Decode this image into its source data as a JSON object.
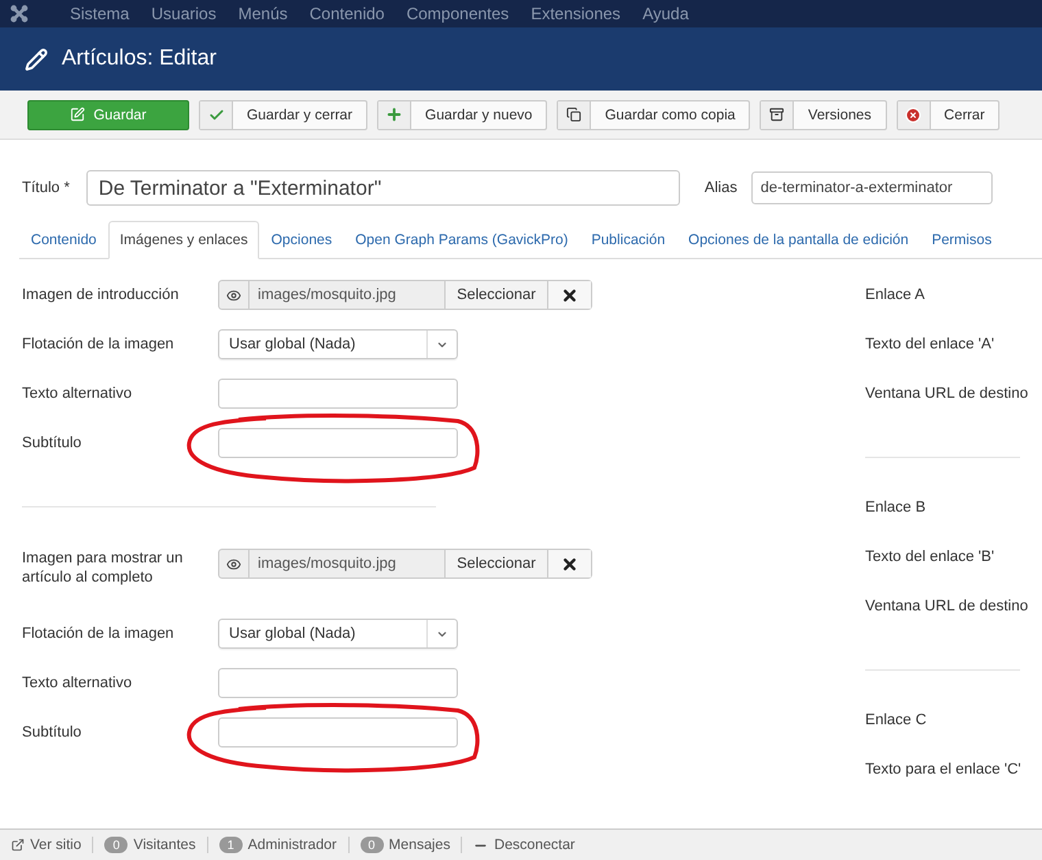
{
  "top_menu": {
    "items": [
      "Sistema",
      "Usuarios",
      "Menús",
      "Contenido",
      "Componentes",
      "Extensiones",
      "Ayuda"
    ]
  },
  "header": {
    "title": "Artículos: Editar"
  },
  "toolbar": {
    "buttons": [
      {
        "label": "Guardar",
        "kind": "primary"
      },
      {
        "label": "Guardar y cerrar",
        "kind": "default"
      },
      {
        "label": "Guardar y nuevo",
        "kind": "default"
      },
      {
        "label": "Guardar como copia",
        "kind": "default"
      },
      {
        "label": "Versiones",
        "kind": "default"
      },
      {
        "label": "Cerrar",
        "kind": "default"
      }
    ]
  },
  "title_field": {
    "label": "Título *",
    "value": "De Terminator a \"Exterminator\""
  },
  "alias_field": {
    "label": "Alias",
    "value": "de-terminator-a-exterminator"
  },
  "tabs": [
    {
      "label": "Contenido",
      "selected": false
    },
    {
      "label": "Imágenes y enlaces",
      "selected": true
    },
    {
      "label": "Opciones",
      "selected": false
    },
    {
      "label": "Open Graph Params (GavickPro)",
      "selected": false
    },
    {
      "label": "Publicación",
      "selected": false
    },
    {
      "label": "Opciones de la pantalla de edición",
      "selected": false
    },
    {
      "label": "Permisos",
      "selected": false
    }
  ],
  "images": {
    "sections": [
      {
        "rows": [
          {
            "kind": "media",
            "label": "Imagen de introducción",
            "value": "images/mosquito.jpg",
            "button": "Seleccionar"
          },
          {
            "kind": "select",
            "label": "Flotación de la imagen",
            "value": "Usar global (Nada)"
          },
          {
            "kind": "text",
            "label": "Texto alternativo",
            "circled": false
          },
          {
            "kind": "text",
            "label": "Subtítulo",
            "circled": true
          }
        ]
      },
      {
        "rows": [
          {
            "kind": "media",
            "label": "Imagen para mostrar un artículo al completo",
            "value": "images/mosquito.jpg",
            "button": "Seleccionar"
          },
          {
            "kind": "select",
            "label": "Flotación de la imagen",
            "value": "Usar global (Nada)"
          },
          {
            "kind": "text",
            "label": "Texto alternativo",
            "circled": false
          },
          {
            "kind": "text",
            "label": "Subtítulo",
            "circled": true
          }
        ]
      }
    ]
  },
  "links": {
    "sections": [
      {
        "rows": [
          "Enlace A",
          "Texto del enlace 'A'",
          "Ventana URL de destino"
        ]
      },
      {
        "rows": [
          "Enlace B",
          "Texto del enlace 'B'",
          "Ventana URL de destino"
        ]
      },
      {
        "rows": [
          "Enlace C",
          "Texto para el enlace 'C'"
        ]
      }
    ]
  },
  "status_bar": {
    "items": [
      {
        "kind": "link",
        "label": "Ver sitio"
      },
      {
        "kind": "count",
        "count": "0",
        "label": "Visitantes"
      },
      {
        "kind": "count",
        "count": "1",
        "label": "Administrador"
      },
      {
        "kind": "count",
        "count": "0",
        "label": "Mensajes"
      },
      {
        "kind": "logout",
        "label": "Desconectar"
      }
    ]
  }
}
